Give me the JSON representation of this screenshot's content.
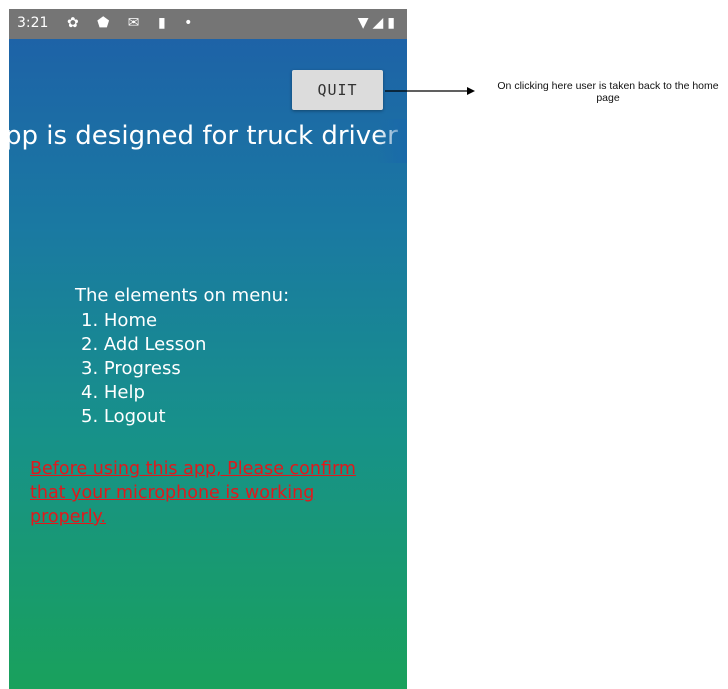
{
  "status_bar": {
    "time": "3:21",
    "left_icons": [
      "settings-icon",
      "shield-icon",
      "gmail-icon",
      "sd-card-icon",
      "dot-icon"
    ],
    "right_icons": [
      "wifi-icon",
      "signal-icon",
      "battery-icon"
    ],
    "left_glyphs": "✿ ⬟ ✉ ▮ •",
    "right_glyphs": "▼◢▮"
  },
  "toolbar": {
    "quit_label": "QUIT"
  },
  "marquee": {
    "text": "pp is designed for truck driver"
  },
  "menu": {
    "title": "The elements on menu:",
    "items": [
      "1. Home",
      "2. Add Lesson",
      "3. Progress",
      "4. Help",
      "5. Logout"
    ]
  },
  "warning": {
    "text": "Before using this app, Please confirm that your microphone is working properly.",
    "color": "#e0191c"
  },
  "annotation": {
    "text": "On clicking here user is taken back to the home page"
  },
  "colors": {
    "gradient_top": "#1e5fa8",
    "gradient_bottom": "#19a15c",
    "status_bar": "#757575",
    "button_bg": "#dcdcdc"
  }
}
